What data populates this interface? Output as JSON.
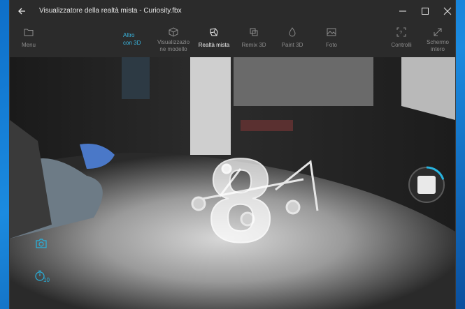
{
  "window": {
    "title": "Visualizzatore della realtà mista - Curiosity.fbx"
  },
  "toolbar": {
    "menu": "Menu",
    "altro": "Altro\ncon 3D",
    "view_model": "Visualizzazio\nne modello",
    "mixed_reality": "Realtà mista",
    "remix": "Remix 3D",
    "paint": "Paint 3D",
    "photo": "Foto",
    "controls": "Controlli",
    "fullscreen": "Schermo\nintero"
  },
  "capture": {
    "countdown": "8",
    "timer_label": "10",
    "record_progress": 0.2
  },
  "colors": {
    "accent": "#27b4e0"
  }
}
